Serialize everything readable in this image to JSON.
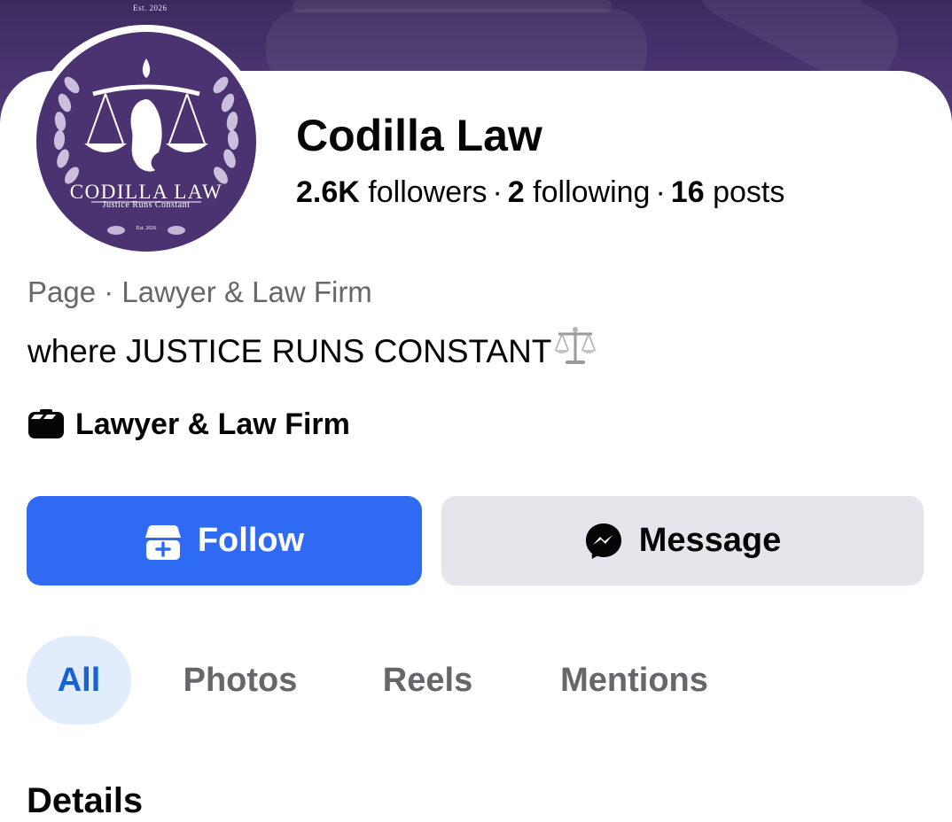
{
  "cover": {
    "est_label": "Est. 2026"
  },
  "avatar": {
    "brand": "CODILLA LAW",
    "tagline": "Justice Runs Constant",
    "est": "Est. 2026"
  },
  "profile": {
    "name": "Codilla Law",
    "followers_count": "2.6K",
    "followers_label": "followers",
    "following_count": "2",
    "following_label": "following",
    "posts_count": "16",
    "posts_label": "posts",
    "separator": "·"
  },
  "category_line": "Page · Lawyer & Law Firm",
  "bio": "where JUSTICE RUNS CONSTANT",
  "bio_icon": "balance-scale-emoji",
  "detail": {
    "icon": "briefcase-icon",
    "text": "Lawyer & Law Firm"
  },
  "actions": {
    "follow_label": "Follow",
    "follow_icon": "follow-page-icon",
    "message_label": "Message",
    "message_icon": "messenger-icon"
  },
  "tabs": [
    {
      "label": "All",
      "active": true
    },
    {
      "label": "Photos",
      "active": false
    },
    {
      "label": "Reels",
      "active": false
    },
    {
      "label": "Mentions",
      "active": false
    }
  ],
  "section": {
    "title": "Details"
  },
  "colors": {
    "brand_purple": "#4a3370",
    "follow_blue": "#2f6bf2",
    "active_tab_text": "#1763d6",
    "active_tab_bg": "#e1edfc",
    "secondary_text": "#65676b"
  }
}
